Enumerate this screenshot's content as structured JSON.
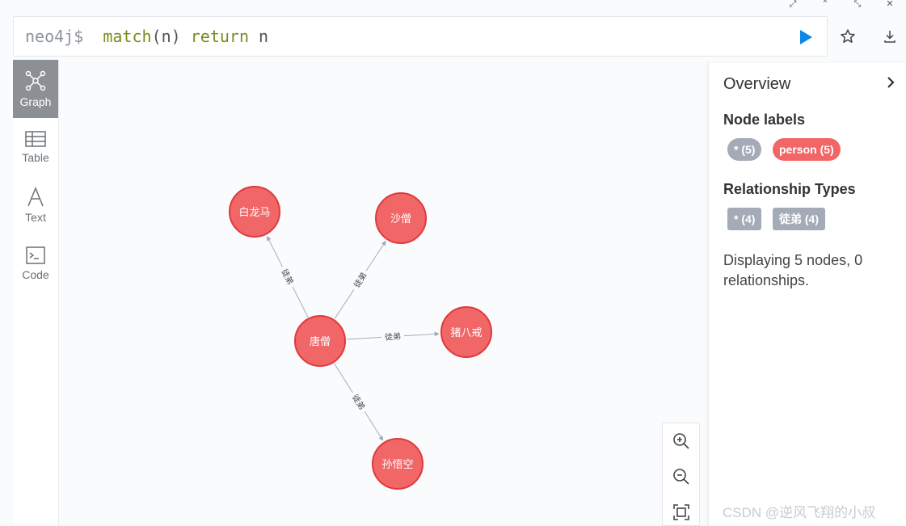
{
  "window": {
    "controls": [
      "⤢",
      "⌃",
      "⤡",
      "✕"
    ]
  },
  "editor": {
    "prompt": "neo4j$",
    "query_kw1": "match",
    "query_mid": "(n)",
    "query_kw2": "return",
    "query_end": "n"
  },
  "sidebar": {
    "items": [
      {
        "label": "Graph",
        "icon": "graph-icon"
      },
      {
        "label": "Table",
        "icon": "table-icon"
      },
      {
        "label": "Text",
        "icon": "text-icon"
      },
      {
        "label": "Code",
        "icon": "code-icon"
      }
    ]
  },
  "graph": {
    "nodes": [
      {
        "id": "center",
        "name": "唐僧"
      },
      {
        "id": "n1",
        "name": "白龙马"
      },
      {
        "id": "n2",
        "name": "沙僧"
      },
      {
        "id": "n3",
        "name": "猪八戒"
      },
      {
        "id": "n4",
        "name": "孙悟空"
      }
    ],
    "relationships": [
      {
        "from": "center",
        "to": "n1",
        "type": "徒弟"
      },
      {
        "from": "center",
        "to": "n2",
        "type": "徒弟"
      },
      {
        "from": "center",
        "to": "n3",
        "type": "徒弟"
      },
      {
        "from": "center",
        "to": "n4",
        "type": "徒弟"
      }
    ],
    "node_color": "#f16667",
    "node_border": "#e0393c"
  },
  "overview": {
    "title": "Overview",
    "node_labels_heading": "Node labels",
    "node_labels": [
      {
        "text": "* (5)",
        "color": "#a5abb6"
      },
      {
        "text": "person (5)",
        "color": "#f16667"
      }
    ],
    "rel_types_heading": "Relationship Types",
    "rel_types": [
      {
        "text": "* (4)",
        "color": "#a5abb6"
      },
      {
        "text": "徒弟 (4)",
        "color": "#a5abb6"
      }
    ],
    "status": "Displaying 5 nodes, 0 relationships."
  },
  "watermark": "CSDN @逆风飞翔的小叔"
}
